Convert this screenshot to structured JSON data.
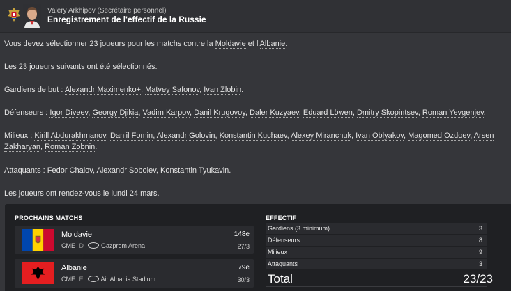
{
  "header": {
    "sender": "Valery Arkhipov  (Secrétaire personnel)",
    "subject": "Enregistrement de l'effectif de la Russie"
  },
  "message": {
    "line1_before": "Vous devez sélectionner 23 joueurs pour les matchs contre la ",
    "line1_team1": "Moldavie",
    "line1_mid": " et l'",
    "line1_team2": "Albanie",
    "line1_end": ".",
    "line2": "Les 23 joueurs suivants ont été sélectionnés.",
    "goalkeepers_label": "Gardiens de but : ",
    "goalkeepers": [
      "Alexandr Maximenko+",
      "Matvey Safonov",
      "Ivan Zlobin"
    ],
    "defenders_label": "Défenseurs : ",
    "defenders": [
      "Igor Diveev",
      "Georgy Djikia",
      "Vadim Karpov",
      "Danil Krugovoy",
      "Daler Kuzyaev",
      "Eduard Löwen",
      "Dmitry Skopintsev",
      "Roman Yevgenjev"
    ],
    "midfielders_label": "Milieux : ",
    "midfielders": [
      "Kirill Abdurakhmanov",
      "Daniil Fomin",
      "Alexandr Golovin",
      "Konstantin Kuchaev",
      "Alexey Miranchuk",
      "Ivan Oblyakov",
      "Magomed Ozdoev",
      "Arsen Zakharyan",
      "Roman Zobnin"
    ],
    "attackers_label": "Attaquants : ",
    "attackers": [
      "Fedor Chalov",
      "Alexandr Sobolev",
      "Konstantin Tyukavin"
    ],
    "closing": "Les joueurs ont rendez-vous le lundi 24 mars."
  },
  "matches": {
    "title": "PROCHAINS MATCHS",
    "items": [
      {
        "team": "Moldavie",
        "competition": "CME",
        "venue_code": "D",
        "stadium": "Gazprom Arena",
        "rank": "148e",
        "date": "27/3",
        "flag_colors": [
          "#0046ae",
          "#ffd200",
          "#cc092f"
        ]
      },
      {
        "team": "Albanie",
        "competition": "CME",
        "venue_code": "E",
        "stadium": "Air Albania Stadium",
        "rank": "79e",
        "date": "30/3",
        "flag_colors": [
          "#e41e20",
          "#000000"
        ]
      }
    ]
  },
  "squad": {
    "title": "EFFECTIF",
    "rows": [
      {
        "label": "Gardiens (3 minimum)",
        "value": "3"
      },
      {
        "label": "Défenseurs",
        "value": "8"
      },
      {
        "label": "Milieux",
        "value": "9"
      },
      {
        "label": "Attaquants",
        "value": "3"
      }
    ],
    "total_label": "Total",
    "total_value": "23/23"
  }
}
